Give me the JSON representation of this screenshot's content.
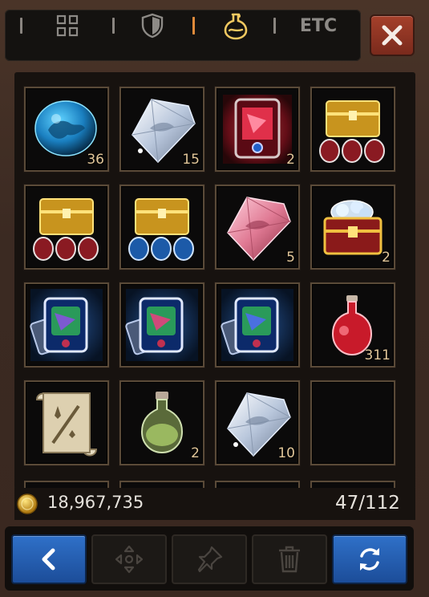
{
  "tabs": [
    {
      "name": "all-items",
      "icon": "grid-icon",
      "active": false
    },
    {
      "name": "equipment",
      "icon": "shield-icon",
      "active": false
    },
    {
      "name": "consumables",
      "icon": "potion-icon",
      "active": true
    },
    {
      "name": "etc",
      "label": "ETC",
      "active": false
    }
  ],
  "close_icon": "close-icon",
  "inventory": {
    "slots": [
      {
        "item": "blue-dragon-gem",
        "quantity": "36"
      },
      {
        "item": "white-diamond",
        "quantity": "15"
      },
      {
        "item": "red-card",
        "quantity": "2"
      },
      {
        "item": "gold-chest-red-gems",
        "quantity": ""
      },
      {
        "item": "gold-chest-red-gems",
        "quantity": ""
      },
      {
        "item": "gold-chest-blue-gems",
        "quantity": ""
      },
      {
        "item": "pink-diamond",
        "quantity": "5"
      },
      {
        "item": "red-chest-diamonds",
        "quantity": "2"
      },
      {
        "item": "blue-card-stack",
        "quantity": ""
      },
      {
        "item": "blue-card-stack",
        "quantity": ""
      },
      {
        "item": "blue-card-stack",
        "quantity": ""
      },
      {
        "item": "red-potion",
        "quantity": "311"
      },
      {
        "item": "scroll",
        "quantity": ""
      },
      {
        "item": "green-potion",
        "quantity": "2"
      },
      {
        "item": "white-diamond",
        "quantity": "10"
      },
      {
        "item": "empty",
        "quantity": ""
      }
    ]
  },
  "currency": {
    "icon": "gold-coin-icon",
    "amount": "18,967,735"
  },
  "capacity": "47/112",
  "bottom_buttons": [
    {
      "name": "back-button",
      "icon": "chevron-left-icon",
      "enabled": true
    },
    {
      "name": "move-button",
      "icon": "move-arrows-icon",
      "enabled": false
    },
    {
      "name": "pin-button",
      "icon": "pin-icon",
      "enabled": false
    },
    {
      "name": "delete-button",
      "icon": "trash-icon",
      "enabled": false
    },
    {
      "name": "refresh-button",
      "icon": "refresh-icon",
      "enabled": true
    }
  ],
  "colors": {
    "accent": "#e08a3a",
    "button_blue": "#2f70c8",
    "close_red": "#a5402b",
    "quantity_text": "#e2c79a"
  }
}
